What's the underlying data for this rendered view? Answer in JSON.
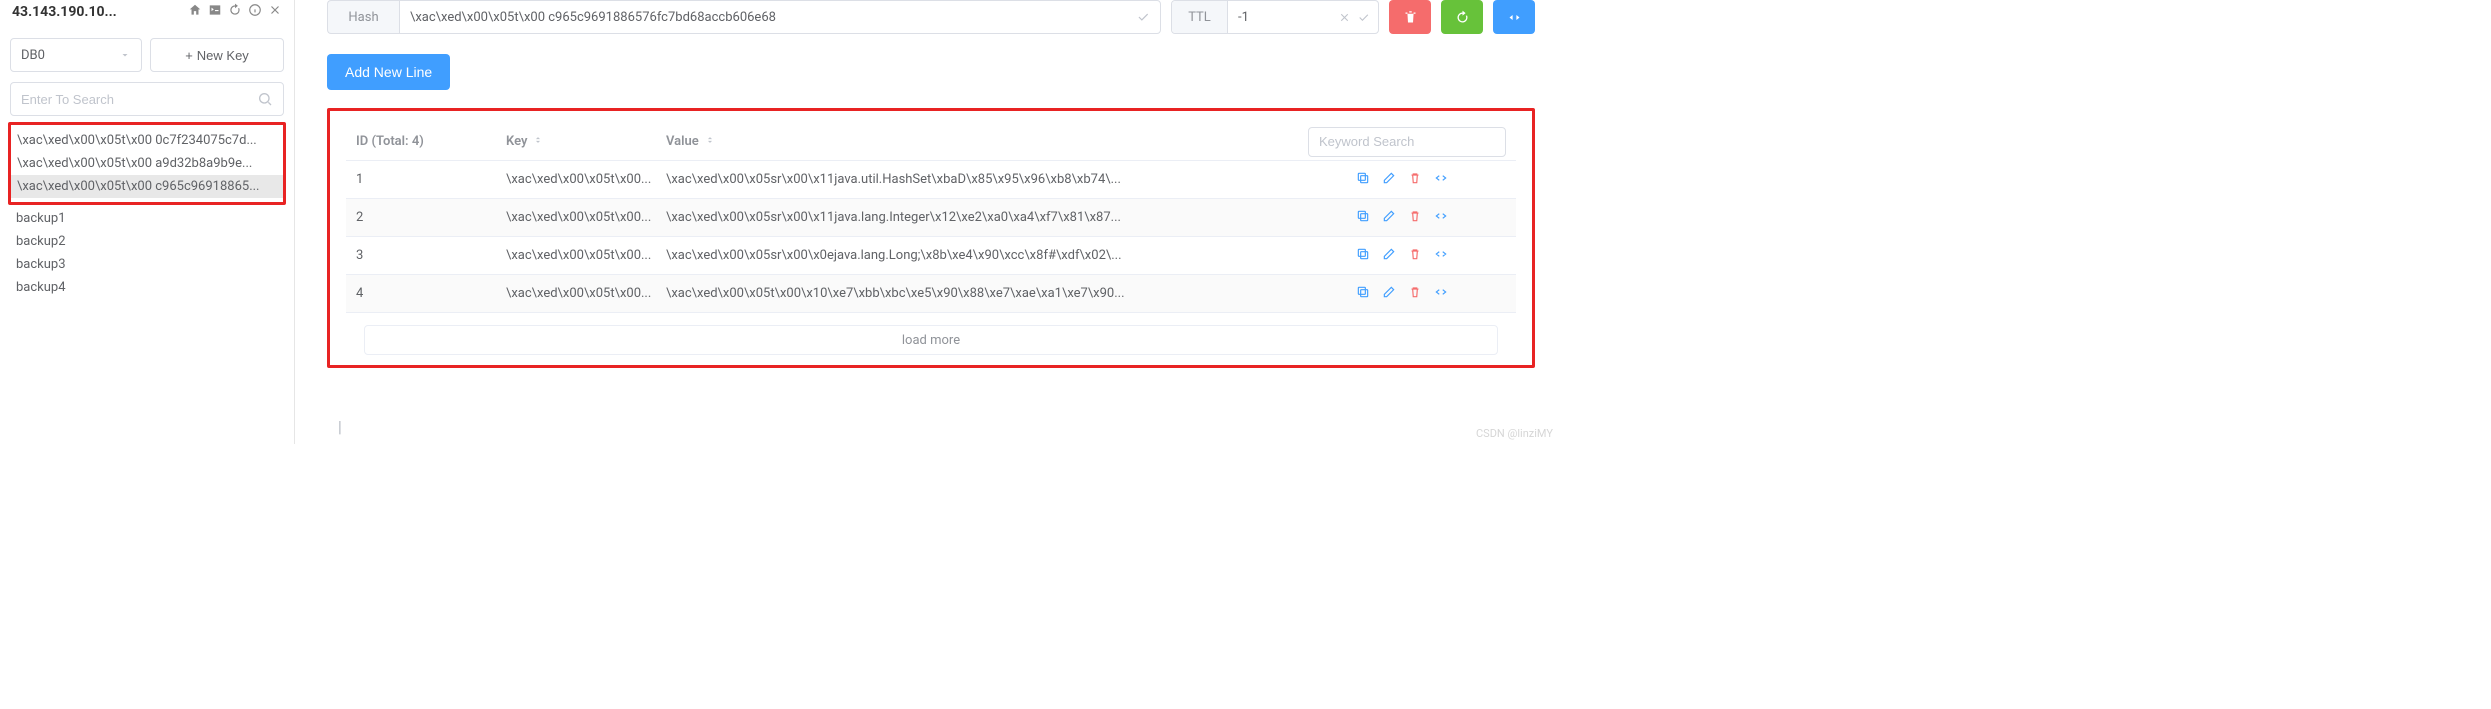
{
  "sidebar": {
    "conn_title": "43.143.190.10...",
    "db_selected": "DB0",
    "new_key_label": "New Key",
    "search_placeholder": "Enter To Search",
    "highlight_keys": [
      "\\xac\\xed\\x00\\x05t\\x00 0c7f234075c7d...",
      "\\xac\\xed\\x00\\x05t\\x00 a9d32b8a9b9e...",
      "\\xac\\xed\\x00\\x05t\\x00 c965c96918865..."
    ],
    "selected_index": 2,
    "plain_keys": [
      "backup1",
      "backup2",
      "backup3",
      "backup4"
    ]
  },
  "editor": {
    "type_label": "Hash",
    "key_value": "\\xac\\xed\\x00\\x05t\\x00 c965c9691886576fc7bd68accb606e68",
    "ttl_label": "TTL",
    "ttl_value": "-1"
  },
  "buttons": {
    "add_new_line": "Add New Line"
  },
  "table": {
    "id_header": "ID (Total: 4)",
    "key_header": "Key",
    "value_header": "Value",
    "keyword_search_placeholder": "Keyword Search",
    "load_more": "load more",
    "rows": [
      {
        "id": "1",
        "key": "\\xac\\xed\\x00\\x05t\\x00...",
        "value": "\\xac\\xed\\x00\\x05sr\\x00\\x11java.util.HashSet\\xbaD\\x85\\x95\\x96\\xb8\\xb74\\..."
      },
      {
        "id": "2",
        "key": "\\xac\\xed\\x00\\x05t\\x00...",
        "value": "\\xac\\xed\\x00\\x05sr\\x00\\x11java.lang.Integer\\x12\\xe2\\xa0\\xa4\\xf7\\x81\\x87..."
      },
      {
        "id": "3",
        "key": "\\xac\\xed\\x00\\x05t\\x00...",
        "value": "\\xac\\xed\\x00\\x05sr\\x00\\x0ejava.lang.Long;\\x8b\\xe4\\x90\\xcc\\x8f#\\xdf\\x02\\..."
      },
      {
        "id": "4",
        "key": "\\xac\\xed\\x00\\x05t\\x00...",
        "value": "\\xac\\xed\\x00\\x05t\\x00\\x10\\xe7\\xbb\\xbc\\xe5\\x90\\x88\\xe7\\xae\\xa1\\xe7\\x90..."
      }
    ]
  },
  "watermark": "CSDN @linziMY"
}
